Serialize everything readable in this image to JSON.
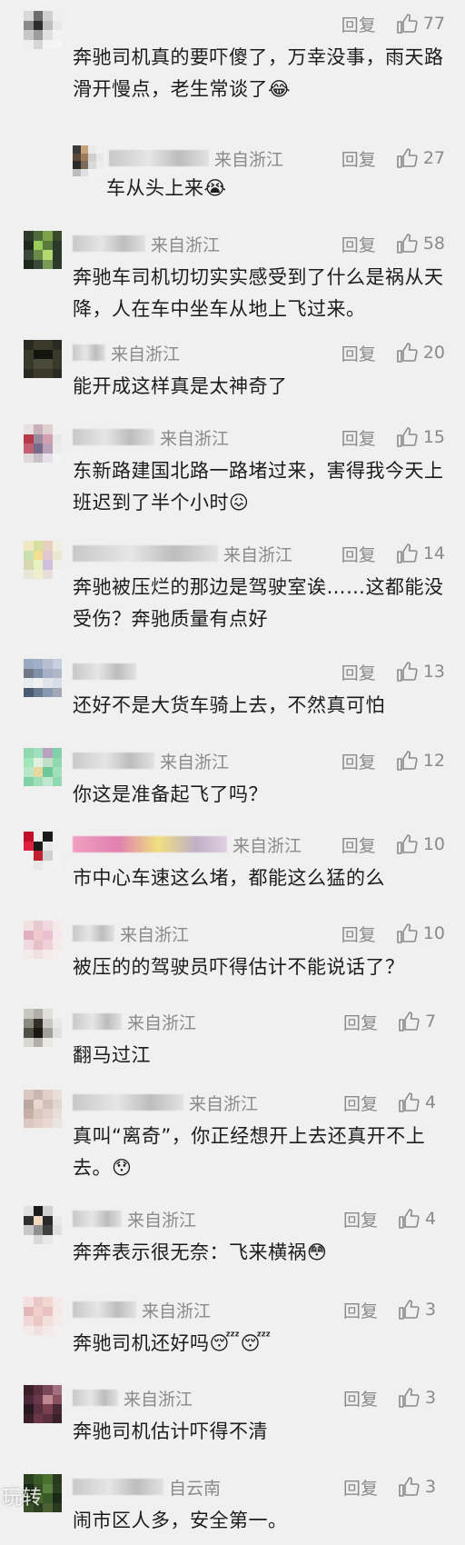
{
  "comments": [
    {
      "location": "",
      "reply_label": "回复",
      "likes": "77",
      "text": "奔驰司机真的要吓傻了，万幸没事，雨天路滑开慢点，老生常谈了😂",
      "avatar": [
        "#d9d9d9",
        "#6d6d6d",
        "#d0d0d0",
        "#efefef",
        "#8a8a8a",
        "#2b2b2b",
        "#bdbdbd",
        "#e8e8e8",
        "#c7c7c7",
        "#9d9d9d",
        "#e0e0e0",
        "#f2f2f2",
        "#efefef",
        "#d6d6d6",
        "#f3f3f3",
        "#f5f5f5"
      ]
    },
    {
      "location": "来自浙江",
      "reply_label": "回复",
      "likes": "27",
      "is_reply": true,
      "text": "车从头上来😭",
      "avatar": [
        "#3a3a3a",
        "#c7a27a",
        "#eaeaea",
        "#f0f0f0",
        "#5a4a3a",
        "#9c7a5a",
        "#cfcfcf",
        "#e8e8e8",
        "#2b2b2b",
        "#7a6a5a",
        "#d9d9d9",
        "#ececec",
        "#bdbdbd",
        "#e0e0e0",
        "#f2f2f2",
        "#f2f2f2"
      ]
    },
    {
      "location": "来自浙江",
      "reply_label": "回复",
      "likes": "58",
      "text": "奔驰车司机切切实实感受到了什么是祸从天降，人在车中坐车从地上飞过来。",
      "avatar": [
        "#2f3a2a",
        "#4f6a3a",
        "#7fa04a",
        "#3a4a2a",
        "#1f2a1f",
        "#9acb5a",
        "#5a7a3a",
        "#2a3a2a",
        "#3a4a3a",
        "#6a8a4a",
        "#b5d870",
        "#2a3a2a",
        "#1f2a1f",
        "#3a4a3a",
        "#7a9a5a",
        "#2f3a2a"
      ]
    },
    {
      "location": "来自浙江",
      "reply_label": "回复",
      "likes": "20",
      "text": "能开成这样真是太神奇了",
      "avatar": [
        "#2a2a22",
        "#3a3a2a",
        "#3a3a2a",
        "#2a2a22",
        "#3a3a2a",
        "#141410",
        "#141410",
        "#3a3a2a",
        "#3a3a2a",
        "#4a4a3a",
        "#4a4a3a",
        "#3a3a2a",
        "#2a2a22",
        "#3a3a2a",
        "#3a3a2a",
        "#2a2a22"
      ]
    },
    {
      "location": "来自浙江",
      "reply_label": "回复",
      "likes": "15",
      "text": "东新路建国北路一路堵过来，害得我今天上班迟到了半个小时😖",
      "avatar": [
        "#e8e0e0",
        "#c8b0b8",
        "#e0d0d0",
        "#f0f0f0",
        "#b83a4a",
        "#9a8aa0",
        "#d0a0b0",
        "#e8e8e8",
        "#c06070",
        "#7a6a8a",
        "#b8a0b8",
        "#ececec",
        "#e0d8d8",
        "#c8c0c8",
        "#e8e0e8",
        "#f2f2f2"
      ]
    },
    {
      "location": "来自浙江",
      "reply_label": "回复",
      "likes": "14",
      "text": "奔驰被压烂的那边是驾驶室诶……这都能没受伤？奔驰质量有点好",
      "avatar": [
        "#f0e8c0",
        "#d8e0a0",
        "#e8d0c0",
        "#f0f0e0",
        "#c8e0b0",
        "#f0e090",
        "#e0c8d0",
        "#e8e8d0",
        "#d8d8b0",
        "#e8f0c0",
        "#d0c0e0",
        "#f0f0e8",
        "#e8e8d8",
        "#f0f0d0",
        "#e8e0d8",
        "#f2f2f2"
      ]
    },
    {
      "location": "",
      "reply_label": "回复",
      "likes": "13",
      "text": "还好不是大货车骑上去，不然真可怕",
      "avatar": [
        "#9aa8c0",
        "#a0b0c8",
        "#b8c0d0",
        "#c8d0e0",
        "#707888",
        "#8090a8",
        "#a8b0c8",
        "#b0b8c8",
        "#e8ecf0",
        "#f0f0f0",
        "#e0e4ea",
        "#d8dce4",
        "#4a5a70",
        "#6a7a90",
        "#8898b0",
        "#a0a8b8"
      ]
    },
    {
      "location": "来自浙江",
      "reply_label": "回复",
      "likes": "12",
      "text": "你这是准备起飞了吗？",
      "avatar": [
        "#90d8b0",
        "#a0e0c0",
        "#b8a0c0",
        "#80d0a8",
        "#a0e8b8",
        "#e0f0e0",
        "#c0e0c8",
        "#90d8b0",
        "#b8e8c8",
        "#e8d8a0",
        "#70c898",
        "#a0e0b8",
        "#80d0a8",
        "#a0e0b8",
        "#c0e8d0",
        "#90d8b0"
      ]
    },
    {
      "location": "来自浙江",
      "reply_label": "回复",
      "likes": "10",
      "text": "市中心车速这么堵，都能这么猛的么",
      "avatar": [
        "#c0102a",
        "#f0f0f0",
        "#1a1a1a",
        "#f0f0f0",
        "#e02040",
        "#1a1a1a",
        "#e8e8e8",
        "#f0f0f0",
        "#f0f0f0",
        "#c02030",
        "#d0d0d0",
        "#f2f2f2",
        "#f0f0f0",
        "#e8e8e8",
        "#f0f0f0",
        "#f2f2f2"
      ]
    },
    {
      "location": "来自浙江",
      "reply_label": "回复",
      "likes": "10",
      "text": "被压的的驾驶员吓得估计不能说话了？",
      "avatar": [
        "#f0e0e0",
        "#e8c8d0",
        "#f0d8e0",
        "#f4eaea",
        "#e0b0c0",
        "#f0c8d0",
        "#e8c0d0",
        "#f4e8ec",
        "#f0d8e0",
        "#e8c0c8",
        "#f0d0d8",
        "#f4eaea",
        "#f4eaea",
        "#f0e0e4",
        "#f4eaea",
        "#f4eeee"
      ]
    },
    {
      "location": "来自浙江",
      "reply_label": "回复",
      "likes": "7",
      "text": "翻马过江",
      "avatar": [
        "#c8c8c0",
        "#b0b0a8",
        "#e0e0d8",
        "#f0f0f0",
        "#8a8a80",
        "#303028",
        "#c8c8c0",
        "#e8e8e8",
        "#505048",
        "#181810",
        "#a0a098",
        "#e0e0e0",
        "#d8d8d0",
        "#b0b0a8",
        "#e8e8e0",
        "#f0f0f0"
      ]
    },
    {
      "location": "来自浙江",
      "reply_label": "回复",
      "likes": "4",
      "text": "真叫“离奇”，你正经想开上去还真开不上去。😯",
      "avatar": [
        "#d8c8c0",
        "#c8b8b0",
        "#e0d0c8",
        "#e8e0d8",
        "#b8a8a0",
        "#e8d8d0",
        "#d0c0b8",
        "#e0d8d0",
        "#c8b0a8",
        "#d8c8c0",
        "#e0d0c8",
        "#e8e0d8",
        "#d8c8c0",
        "#e0d0c8",
        "#e8d8d0",
        "#ece4e0"
      ]
    },
    {
      "location": "来自浙江",
      "reply_label": "回复",
      "likes": "4",
      "text": "奔奔表示很无奈：飞来横祸😳",
      "avatar": [
        "#e0e0e0",
        "#1a1a1a",
        "#d0d0d0",
        "#f0f0f0",
        "#303030",
        "#f0d8c0",
        "#2a2a2a",
        "#e8e8e8",
        "#c8c8c8",
        "#909090",
        "#404040",
        "#e0e0e0",
        "#f0f0f0",
        "#d8d8d8",
        "#e8e8e8",
        "#f2f2f2"
      ]
    },
    {
      "location": "来自浙江",
      "reply_label": "回复",
      "likes": "3",
      "text": "奔驰司机还好吗😴😴",
      "avatar": [
        "#f4e0e0",
        "#e8c8c8",
        "#f0d8d0",
        "#f4eaea",
        "#e0b8b8",
        "#f0d0c8",
        "#e8c0c0",
        "#f4e8e8",
        "#f0d8d8",
        "#e8c8c0",
        "#f0e0d8",
        "#f4eaea",
        "#f4eaea",
        "#f0e0e0",
        "#f4eaea",
        "#f4eeee"
      ]
    },
    {
      "location": "来自浙江",
      "reply_label": "回复",
      "likes": "3",
      "text": "奔驰司机估计吓得不清",
      "avatar": [
        "#3a2028",
        "#5a3040",
        "#7a4858",
        "#a07080",
        "#4a2838",
        "#6a3848",
        "#c08890",
        "#8a5060",
        "#2a1820",
        "#5a3040",
        "#7a4050",
        "#4a2838",
        "#3a2028",
        "#6a3848",
        "#5a3040",
        "#3a2028"
      ]
    },
    {
      "location": "自云南",
      "reply_label": "回复",
      "likes": "3",
      "text": "闹市区人多，安全第一。",
      "avatar": [
        "#2a4020",
        "#3a5a28",
        "#4a7030",
        "#2a3a20",
        "#1a2a18",
        "#3a5028",
        "#5a8040",
        "#2a4020",
        "#2a3a20",
        "#4a6830",
        "#3a5a28",
        "#1a2a18",
        "#3a5028",
        "#2a4020",
        "#4a6030",
        "#2a3a20"
      ]
    }
  ],
  "watermark": "玩转"
}
